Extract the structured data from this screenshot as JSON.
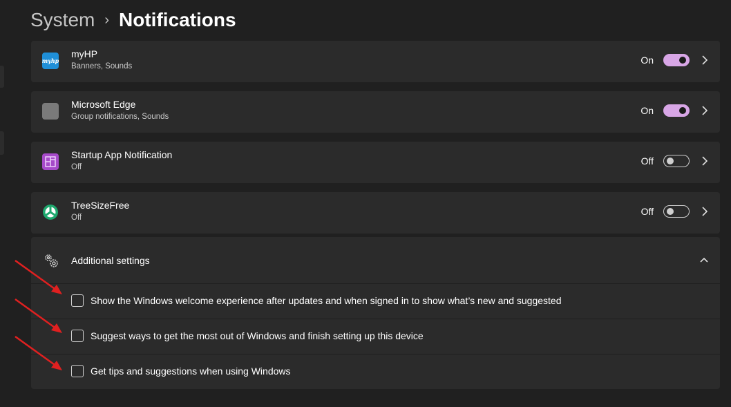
{
  "breadcrumb": {
    "parent": "System",
    "separator": "›",
    "current": "Notifications"
  },
  "apps": [
    {
      "name": "myHP",
      "subtitle": "Banners, Sounds",
      "state": "On",
      "enabled": true,
      "icon": "myhp-logo-icon",
      "icon_text": "myhp",
      "icon_color": "#1f8fd8"
    },
    {
      "name": "Microsoft Edge",
      "subtitle": "Group notifications, Sounds",
      "state": "On",
      "enabled": true,
      "icon": "edge-placeholder-icon",
      "icon_color": "#7a7a7a"
    },
    {
      "name": "Startup App Notification",
      "subtitle": "Off",
      "state": "Off",
      "enabled": false,
      "icon": "startup-app-icon",
      "icon_color": "#a64ac9"
    },
    {
      "name": "TreeSizeFree",
      "subtitle": "Off",
      "state": "Off",
      "enabled": false,
      "icon": "treesize-icon",
      "icon_color": "#1ea86e"
    }
  ],
  "additional": {
    "title": "Additional settings",
    "options": [
      {
        "label": "Show the Windows welcome experience after updates and when signed in to show what’s new and suggested",
        "checked": false
      },
      {
        "label": "Suggest ways to get the most out of Windows and finish setting up this device",
        "checked": false
      },
      {
        "label": "Get tips and suggestions when using Windows",
        "checked": false
      }
    ]
  },
  "colors": {
    "background": "#202020",
    "card": "#2b2b2b",
    "accent": "#d8a6e6",
    "annotation_arrow": "#e02020"
  }
}
